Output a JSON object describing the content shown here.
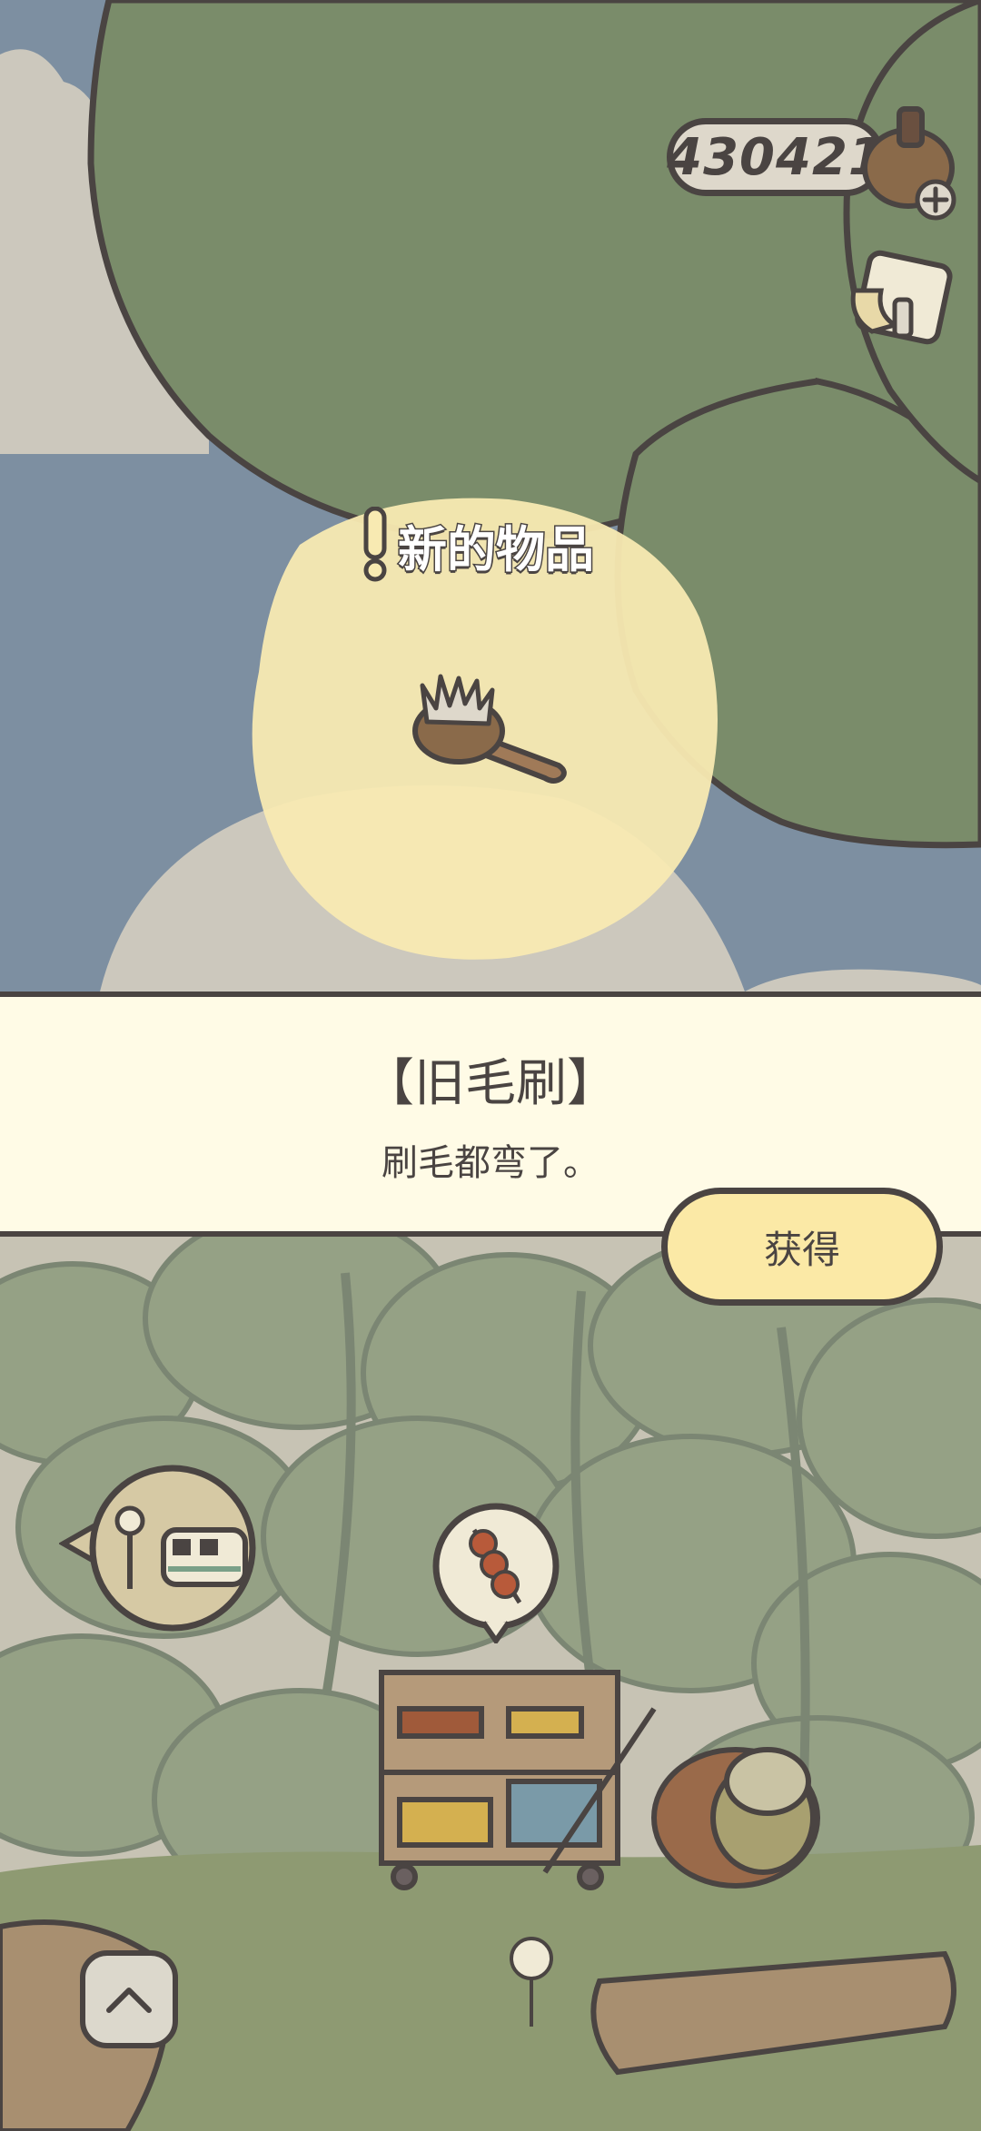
{
  "hud": {
    "clover_count": "430421"
  },
  "notification": {
    "new_item_label": "新的物品"
  },
  "item": {
    "name": "【旧毛刷】",
    "description": "刷毛都弯了。"
  },
  "actions": {
    "get_label": "获得"
  },
  "icons": {
    "clover_add": "clover-pot-plus-icon",
    "mailbox": "mailbox-icon",
    "exclamation": "exclamation-icon",
    "old_brush": "old-brush-icon",
    "train_bubble": "train-station-bubble-icon",
    "dango_bubble": "dango-speech-bubble-icon",
    "up_button": "chevron-up-icon"
  },
  "colors": {
    "outline": "#4a4442",
    "leaf_green": "#7a8c6a",
    "sky_blue": "#7d8fa1",
    "cloud": "#ccc8bd",
    "highlight_yellow": "#f8eab2",
    "banner_bg": "#fffbe6",
    "button_yellow": "#fbe9a6"
  }
}
